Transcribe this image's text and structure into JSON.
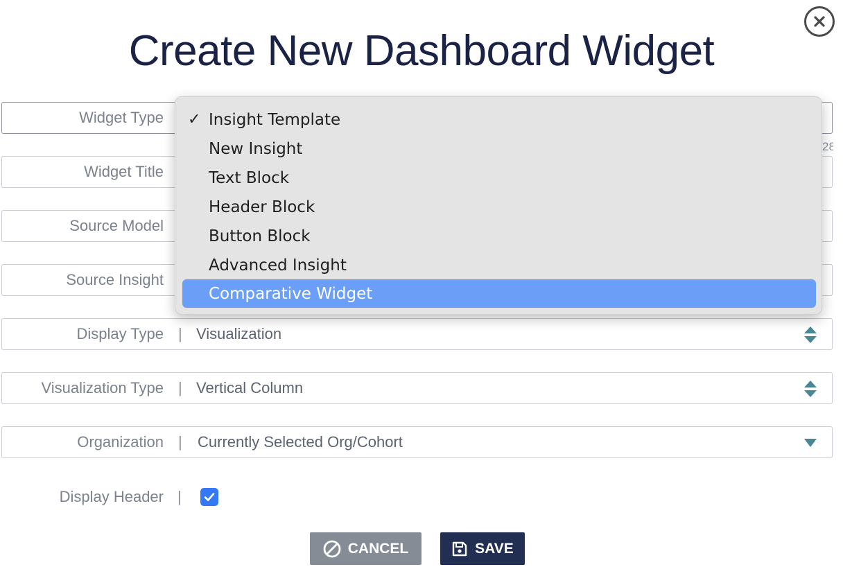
{
  "dialog": {
    "title": "Create New Dashboard Widget",
    "close_icon": "close-x-icon"
  },
  "form": {
    "widget_type": {
      "label": "Widget Type",
      "value": "Insight Template"
    },
    "widget_title": {
      "label": "Widget Title",
      "char_count": "28"
    },
    "source_model": {
      "label": "Source Model"
    },
    "source_insight": {
      "label": "Source Insight"
    },
    "display_type": {
      "label": "Display Type",
      "separator": "|",
      "value": "Visualization"
    },
    "visualization_type": {
      "label": "Visualization Type",
      "separator": "|",
      "value": "Vertical Column"
    },
    "organization": {
      "label": "Organization",
      "separator": "|",
      "value": "Currently Selected Org/Cohort"
    },
    "display_header": {
      "label": "Display Header",
      "separator": "|",
      "checked": true
    }
  },
  "dropdown": {
    "items": [
      {
        "label": "Insight Template",
        "checked": true
      },
      {
        "label": "New Insight"
      },
      {
        "label": "Text Block"
      },
      {
        "label": "Header Block"
      },
      {
        "label": "Button Block"
      },
      {
        "label": "Advanced Insight"
      },
      {
        "label": "Comparative Widget",
        "highlighted": true
      }
    ],
    "check_glyph": "✓"
  },
  "buttons": {
    "cancel_label": "CANCEL",
    "save_label": "SAVE"
  },
  "colors": {
    "title": "#1a2246",
    "highlight": "#6a9ef7",
    "save_button": "#222e52",
    "cancel_button": "#858c96",
    "checkbox": "#3478f6",
    "stepper": "#4a8794"
  }
}
